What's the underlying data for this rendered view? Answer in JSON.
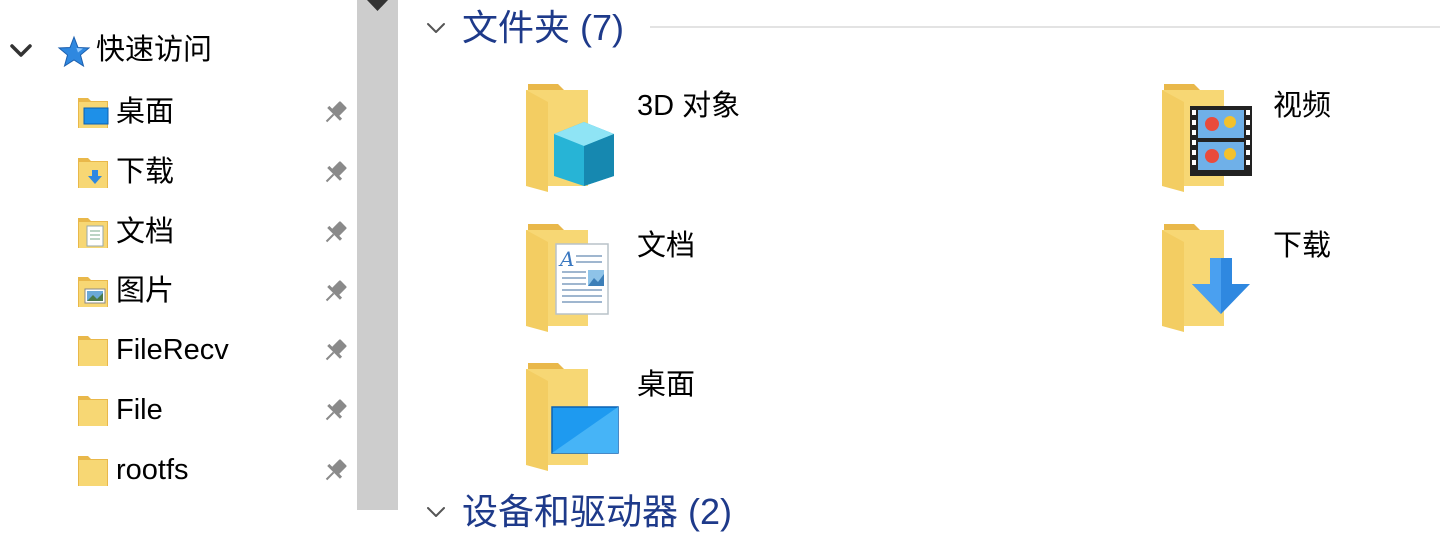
{
  "nav": {
    "quick_access_label": "快速访问",
    "items": [
      {
        "label": "桌面",
        "icon": "desktop-folder-icon"
      },
      {
        "label": "下载",
        "icon": "downloads-folder-icon"
      },
      {
        "label": "文档",
        "icon": "documents-folder-icon"
      },
      {
        "label": "图片",
        "icon": "pictures-folder-icon"
      },
      {
        "label": "FileRecv",
        "icon": "folder-icon"
      },
      {
        "label": "File",
        "icon": "folder-icon"
      },
      {
        "label": "rootfs",
        "icon": "folder-icon"
      }
    ]
  },
  "content": {
    "folders_group_title": "文件夹 (7)",
    "devices_group_title": "设备和驱动器 (2)",
    "folders": [
      {
        "label": "3D 对象",
        "icon": "3d-objects-folder-icon"
      },
      {
        "label": "视频",
        "icon": "videos-folder-icon"
      },
      {
        "label": "文档",
        "icon": "documents-folder-icon"
      },
      {
        "label": "下载",
        "icon": "downloads-folder-icon"
      },
      {
        "label": "桌面",
        "icon": "desktop-folder-icon"
      }
    ]
  },
  "colors": {
    "group_title": "#1e3a8a",
    "folder_yellow": "#f7d774",
    "scrollbar": "#cdcdcd",
    "accent_blue": "#3a8ee6"
  }
}
